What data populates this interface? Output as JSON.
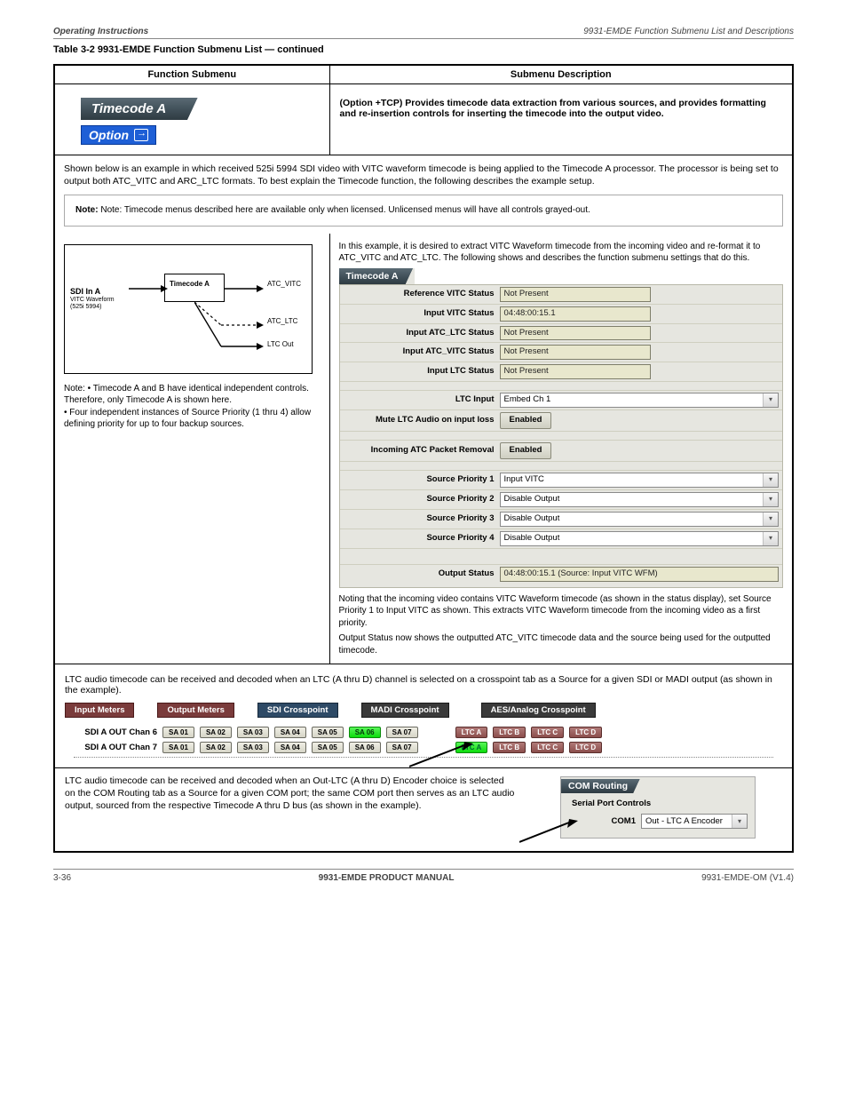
{
  "header": {
    "left": "Operating Instructions",
    "right_title": "9931-EMDE Function Submenu List and Descriptions",
    "table_caption": "Table 3-2  9931-EMDE Function Submenu List — continued"
  },
  "columns": {
    "func": "Function Submenu",
    "sub": "Submenu Description"
  },
  "panel": {
    "tab": "Timecode A",
    "option_label": "Option",
    "lic_note": "(Option +TCP) Provides timecode data extraction from various sources, and provides formatting and re-insertion controls for inserting the timecode into the output video.",
    "shown_as": "Shown below is an example in which received 525i 5994 SDI video with VITC waveform timecode is being applied to the Timecode A processor. The processor is being set to output both ATC_VITC and ARC_LTC formats. To best explain the Timecode function, the following describes the example setup.",
    "mandatory_note": "Note: Timecode menus described here are available only when licensed. Unlicensed menus will have all controls grayed-out.",
    "priority_note": "Note: • Timecode A and B have identical independent controls. Therefore, only Timecode A is shown here.\n• Four independent instances of Source Priority (1 thru 4) allow defining priority for up to four backup sources."
  },
  "diagram": {
    "title": "Timecode A",
    "in_label": "SDI In A",
    "in_sub": "VITC Waveform\n(525i 5994)",
    "block": "Timecode A",
    "out1": "ATC_VITC",
    "out2": "ATC_LTC",
    "out3": "LTC Out"
  },
  "status": {
    "tab": "Timecode A",
    "rows": {
      "ref_vitc": {
        "label": "Reference VITC Status",
        "value": "Not Present"
      },
      "in_vitc": {
        "label": "Input VITC Status",
        "value": "04:48:00:15.1"
      },
      "in_atc_ltc": {
        "label": "Input ATC_LTC Status",
        "value": "Not Present"
      },
      "in_atc_vitc": {
        "label": "Input ATC_VITC Status",
        "value": "Not Present"
      },
      "in_ltc": {
        "label": "Input LTC Status",
        "value": "Not Present"
      }
    },
    "ltc_input": {
      "label": "LTC Input",
      "value": "Embed Ch 1"
    },
    "mute": {
      "label": "Mute LTC Audio on input loss",
      "value": "Enabled"
    },
    "atc_removal": {
      "label": "Incoming ATC Packet Removal",
      "value": "Enabled"
    },
    "priority": {
      "p1": {
        "label": "Source Priority 1",
        "value": "Input VITC"
      },
      "p2": {
        "label": "Source Priority 2",
        "value": "Disable Output"
      },
      "p3": {
        "label": "Source Priority 3",
        "value": "Disable Output"
      },
      "p4": {
        "label": "Source Priority 4",
        "value": "Disable Output"
      }
    },
    "output_status": {
      "label": "Output Status",
      "value": "04:48:00:15.1 (Source: Input VITC WFM)"
    }
  },
  "status_text": {
    "intro": "In this example, it is desired to extract VITC Waveform timecode from the incoming video and re-format it to ATC_VITC and ATC_LTC. The following shows and describes the function submenu settings that do this.",
    "noting": "Noting that the incoming video contains VITC Waveform timecode (as shown in the status display), set Source Priority 1 to Input VITC as shown. This extracts VITC Waveform timecode from the incoming video as a first priority.",
    "output_line": "Output Status now shows the outputted ATC_VITC timecode data and the source being used for the outputted timecode."
  },
  "ltc_section": {
    "intro": "LTC audio timecode can be received and decoded when an LTC (A thru D) channel is selected on a crosspoint tab as a Source for a given SDI or MADI output (as shown in the example).",
    "tabs": {
      "t1": "Input Meters",
      "t2": "Output Meters",
      "t3": "SDI Crosspoint",
      "t4": "MADI Crosspoint",
      "t5": "AES/Analog Crosspoint"
    },
    "rows": {
      "r1_label": "SDI A OUT Chan 6",
      "r2_label": "SDI A OUT Chan 7"
    },
    "sa": [
      "SA 01",
      "SA 02",
      "SA 03",
      "SA 04",
      "SA 05",
      "SA 06",
      "SA 07"
    ],
    "tc": [
      "LTC A",
      "LTC B",
      "LTC C",
      "LTC D"
    ]
  },
  "com_section": {
    "text": "LTC audio timecode can be received and decoded when an Out-LTC (A thru D) Encoder choice is selected on the COM Routing tab as a Source for a given COM port; the same COM port then serves as an LTC audio output, sourced from the respective Timecode A thru D bus (as shown in the example).",
    "tab": "COM Routing",
    "sub": "Serial Port Controls",
    "row_label": "COM1",
    "row_value": "Out - LTC A Encoder"
  },
  "footer": {
    "left": "3-36",
    "mid": "9931-EMDE PRODUCT MANUAL",
    "right": "9931-EMDE-OM (V1.4)"
  }
}
